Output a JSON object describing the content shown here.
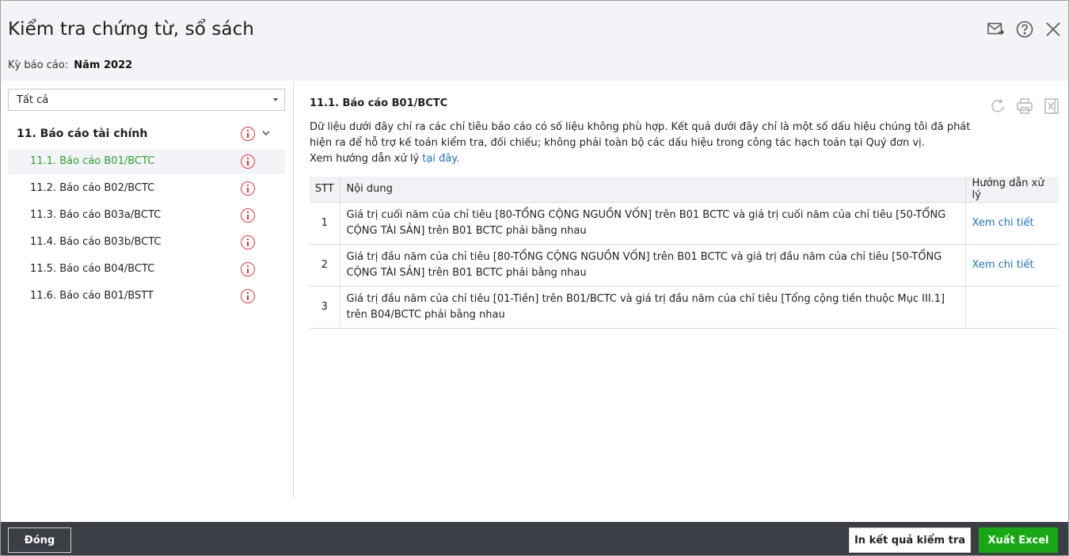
{
  "header": {
    "title": "Kiểm tra chứng từ, sổ sách",
    "period_label": "Kỳ báo cáo:",
    "period_value": "Năm 2022",
    "icons": [
      "mail-forward-icon",
      "help-icon",
      "close-icon"
    ]
  },
  "filter": {
    "selected": "Tất cả"
  },
  "tree": {
    "root_label": "11. Báo cáo tài chính",
    "items": [
      {
        "label": "11.1. Báo cáo B01/BCTC",
        "active": true
      },
      {
        "label": "11.2. Báo cáo B02/BCTC"
      },
      {
        "label": "11.3. Báo cáo B03a/BCTC"
      },
      {
        "label": "11.4. Báo cáo B03b/BCTC"
      },
      {
        "label": "11.5. Báo cáo B04/BCTC"
      },
      {
        "label": "11.6. Báo cáo B01/BSTT"
      }
    ]
  },
  "detail": {
    "title": "11.1. Báo cáo B01/BCTC",
    "description": "Dữ liệu dưới đây chỉ ra các chỉ tiêu báo cáo có số liệu không phù hợp. Kết quả dưới đây chỉ là một số dấu hiệu chúng tôi đã phát hiện ra để hỗ trợ kế toán kiểm tra, đối chiếu; không phải toàn bộ các dấu hiệu trong công tác hạch toán tại Quý đơn vị.",
    "guide_prefix": "Xem hướng dẫn xử lý",
    "guide_link": "tại đây.",
    "columns": {
      "stt": "STT",
      "content": "Nội dung",
      "guide": "Hướng dẫn xử lý"
    },
    "rows": [
      {
        "stt": "1",
        "content": "Giá trị cuối năm của chỉ tiêu [80-TỔNG CỘNG NGUỒN VỐN] trên B01 BCTC và giá trị cuối năm của chỉ tiêu [50-TỔNG CỘNG TÀI SẢN] trên B01 BCTC phải bằng nhau",
        "guide": "Xem chi tiết"
      },
      {
        "stt": "2",
        "content": "Giá trị đầu năm của chỉ tiêu [80-TỔNG CỘNG NGUỒN VỐN] trên B01 BCTC và giá trị đầu năm của chỉ tiêu [50-TỔNG CỘNG TÀI SẢN] trên B01 BCTC phải bằng nhau",
        "guide": "Xem chi tiết"
      },
      {
        "stt": "3",
        "content": "Giá trị đầu năm của chỉ tiêu [01-Tiền] trên B01/BCTC và giá trị đầu năm của chỉ tiêu [Tổng cộng tiền thuộc Mục III.1] trên B04/BCTC phải bằng nhau",
        "guide": ""
      }
    ],
    "tools": [
      "refresh-icon",
      "print-icon",
      "excel-icon"
    ]
  },
  "footer": {
    "close_label": "Đóng",
    "print_label": "In kết quả kiểm tra",
    "excel_label": "Xuất Excel"
  },
  "colors": {
    "accent_green": "#17a813",
    "link_blue": "#1a73c8",
    "warning_red": "#e53935",
    "footer_bg": "#3b3e45"
  }
}
